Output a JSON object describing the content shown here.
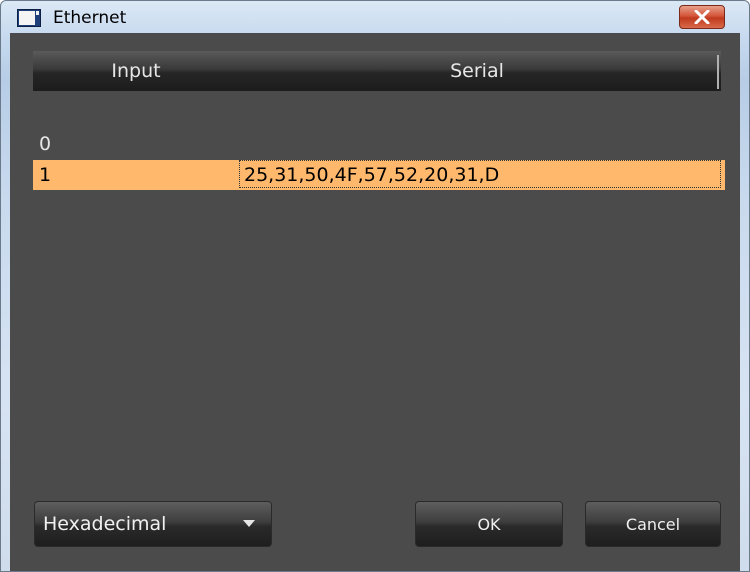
{
  "window": {
    "title": "Ethernet"
  },
  "table": {
    "columns": [
      "Input",
      "Serial"
    ],
    "rows": [
      {
        "input": "0",
        "serial": ""
      },
      {
        "input": "1",
        "serial": "25,31,50,4F,57,52,20,31,D",
        "selected": true
      }
    ]
  },
  "footer": {
    "format_select": "Hexadecimal",
    "ok_label": "OK",
    "cancel_label": "Cancel"
  },
  "colors": {
    "selection": "#ffb86c",
    "panel": "#4b4b4b",
    "close_button": "#d4553a"
  },
  "icons": {
    "app": "window-app-icon",
    "close": "close-icon",
    "dropdown": "chevron-down-icon"
  }
}
